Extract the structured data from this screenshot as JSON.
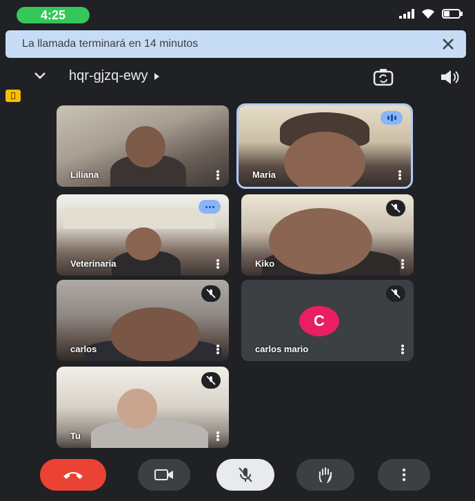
{
  "status_bar": {
    "time": "4:25"
  },
  "banner": {
    "text": "La llamada terminará en 14 minutos"
  },
  "header": {
    "meeting_code": "hqr-gjzq-ewy"
  },
  "participants": [
    {
      "name": "Liliana"
    },
    {
      "name": "Maria"
    },
    {
      "name": "Veterinaria"
    },
    {
      "name": "Kiko"
    },
    {
      "name": "carlos"
    },
    {
      "name": "carlos mario",
      "avatar_letter": "C"
    },
    {
      "name": "Tu"
    }
  ],
  "icons": {
    "banner_close": "close-icon",
    "collapse": "chevron-down-icon",
    "camera_switch": "camera-switch-icon",
    "audio_output": "speaker-icon",
    "tile_menu": "more-vert-icon",
    "muted": "mic-off-icon",
    "speaking": "speaking-indicator-icon",
    "end_call": "phone-hangup-icon",
    "camera": "videocam-icon",
    "mic": "mic-off-icon",
    "raise_hand": "hand-icon",
    "more": "more-vert-icon"
  },
  "colors": {
    "background": "#202124",
    "banner": "#c7dcf5",
    "end_call": "#ea4335",
    "avatar": "#e91e63",
    "status_time": "#34c759",
    "active_outline": "#aecbfa"
  }
}
